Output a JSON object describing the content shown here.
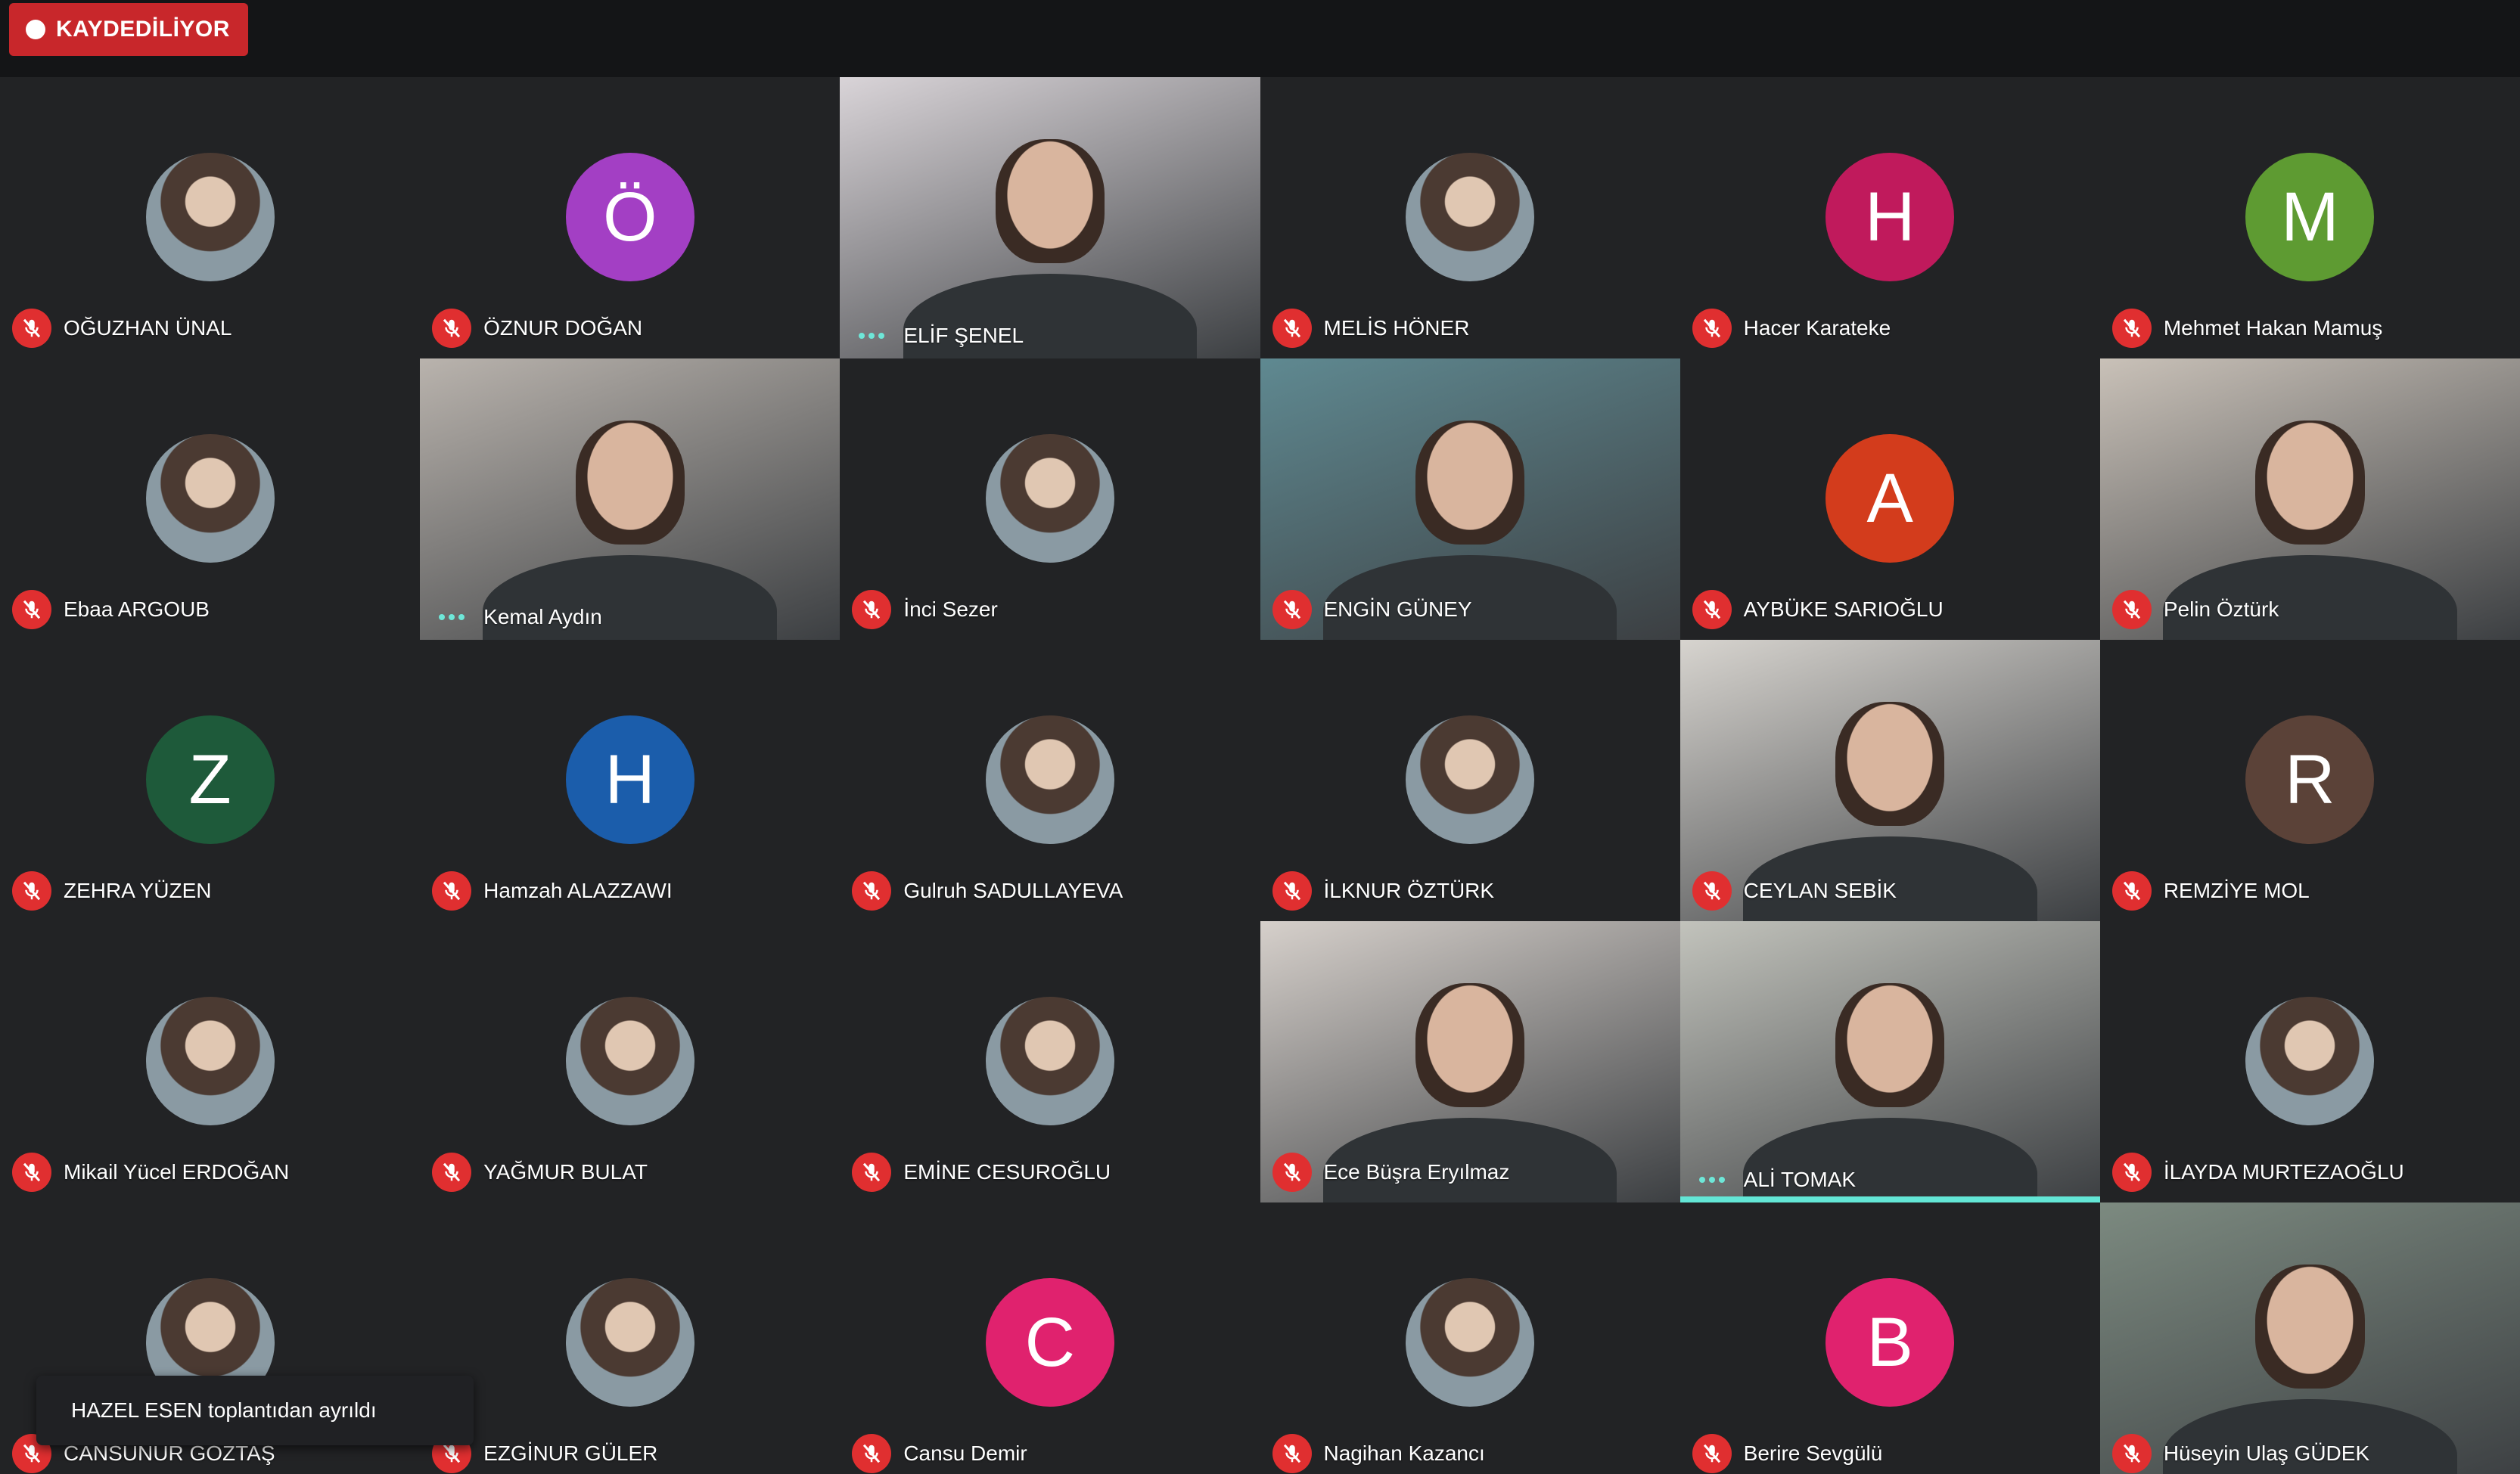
{
  "recording": {
    "label": "KAYDEDİLİYOR",
    "color": "#c8272b"
  },
  "notification": {
    "text": "HAZEL ESEN toplantıdan ayrıldı"
  },
  "colors": {
    "talking_indicator": "#6ee7d8",
    "muted_badge": "#e02f30",
    "active_speaker_bar": "#63e6d6"
  },
  "participants": [
    {
      "name": "OĞUZHAN ÜNAL",
      "status": "muted",
      "view": "avatar-photo",
      "avatar_color": "#ffffff"
    },
    {
      "name": "ÖZNUR DOĞAN",
      "status": "muted",
      "view": "initial",
      "initial": "Ö",
      "avatar_color": "#a33fc4"
    },
    {
      "name": "ELİF ŞENEL",
      "status": "talking",
      "view": "video",
      "bg": "#d9d4d8"
    },
    {
      "name": "MELİS HÖNER",
      "status": "muted",
      "view": "avatar-photo"
    },
    {
      "name": "Hacer Karateke",
      "status": "muted",
      "view": "initial",
      "initial": "H",
      "avatar_color": "#c01a5c"
    },
    {
      "name": "Mehmet Hakan Mamuş",
      "status": "muted",
      "view": "initial",
      "initial": "M",
      "avatar_color": "#5e9b32"
    },
    {
      "name": "Ebaa ARGOUB",
      "status": "muted",
      "view": "avatar-photo"
    },
    {
      "name": "Kemal Aydın",
      "status": "talking",
      "view": "video",
      "bg": "#b9b3ad"
    },
    {
      "name": "İnci Sezer",
      "status": "muted",
      "view": "avatar-photo"
    },
    {
      "name": "ENGİN GÜNEY",
      "status": "muted",
      "view": "video",
      "bg": "#5f8991"
    },
    {
      "name": "AYBÜKE SARIOĞLU",
      "status": "muted",
      "view": "initial",
      "initial": "A",
      "avatar_color": "#d33c1c"
    },
    {
      "name": "Pelin Öztürk",
      "status": "muted",
      "view": "video",
      "bg": "#c9c1b8"
    },
    {
      "name": "ZEHRA YÜZEN",
      "status": "muted",
      "view": "initial",
      "initial": "Z",
      "avatar_color": "#1e5a3a"
    },
    {
      "name": "Hamzah ALAZZAWI",
      "status": "muted",
      "view": "initial",
      "initial": "H",
      "avatar_color": "#1b5dab"
    },
    {
      "name": "Gulruh SADULLAYEVA",
      "status": "muted",
      "view": "avatar-photo"
    },
    {
      "name": "İLKNUR ÖZTÜRK",
      "status": "muted",
      "view": "avatar-photo"
    },
    {
      "name": "CEYLAN SEBİK",
      "status": "muted",
      "view": "video",
      "bg": "#d7d4cf"
    },
    {
      "name": "REMZİYE MOL",
      "status": "muted",
      "view": "initial",
      "initial": "R",
      "avatar_color": "#5b4238"
    },
    {
      "name": "Mikail Yücel ERDOĞAN",
      "status": "muted",
      "view": "avatar-photo"
    },
    {
      "name": "YAĞMUR BULAT",
      "status": "muted",
      "view": "avatar-photo"
    },
    {
      "name": "EMİNE CESUROĞLU",
      "status": "muted",
      "view": "avatar-photo"
    },
    {
      "name": "Ece Büşra Eryılmaz",
      "status": "muted",
      "view": "video",
      "bg": "#d6d0cb"
    },
    {
      "name": "ALİ TOMAK",
      "status": "talking",
      "view": "video",
      "bg": "#c2c3bc",
      "active": true
    },
    {
      "name": "İLAYDA MURTEZAOĞLU",
      "status": "muted",
      "view": "avatar-photo"
    },
    {
      "name": "CANSUNUR GÖZTAŞ",
      "status": "muted",
      "view": "avatar-photo"
    },
    {
      "name": "EZGİNUR GÜLER",
      "status": "muted",
      "view": "avatar-photo"
    },
    {
      "name": "Cansu Demir",
      "status": "muted",
      "view": "initial",
      "initial": "C",
      "avatar_color": "#e0226e"
    },
    {
      "name": "Nagihan Kazancı",
      "status": "muted",
      "view": "avatar-photo"
    },
    {
      "name": "Berire Sevgülü",
      "status": "muted",
      "view": "initial",
      "initial": "B",
      "avatar_color": "#e0226e"
    },
    {
      "name": "Hüseyin Ulaş GÜDEK",
      "status": "muted",
      "view": "video",
      "bg": "#7c8a80"
    }
  ]
}
